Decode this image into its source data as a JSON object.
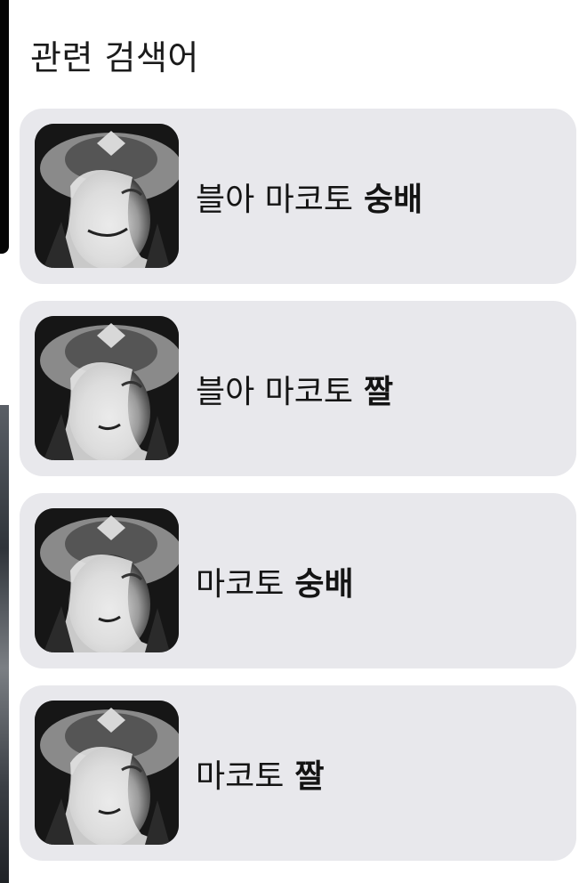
{
  "section": {
    "title": "관련 검색어"
  },
  "suggestions": [
    {
      "query": "블아 마코토",
      "highlight": "숭배",
      "thumbnail_icon": "anime-character-avatar-icon"
    },
    {
      "query": "블아 마코토",
      "highlight": "짤",
      "thumbnail_icon": "anime-character-avatar-icon"
    },
    {
      "query": "마코토",
      "highlight": "숭배",
      "thumbnail_icon": "anime-character-avatar-icon"
    },
    {
      "query": "마코토",
      "highlight": "짤",
      "thumbnail_icon": "anime-character-avatar-icon"
    }
  ],
  "colors": {
    "card_background": "#e8e8ec",
    "text": "#141414"
  }
}
